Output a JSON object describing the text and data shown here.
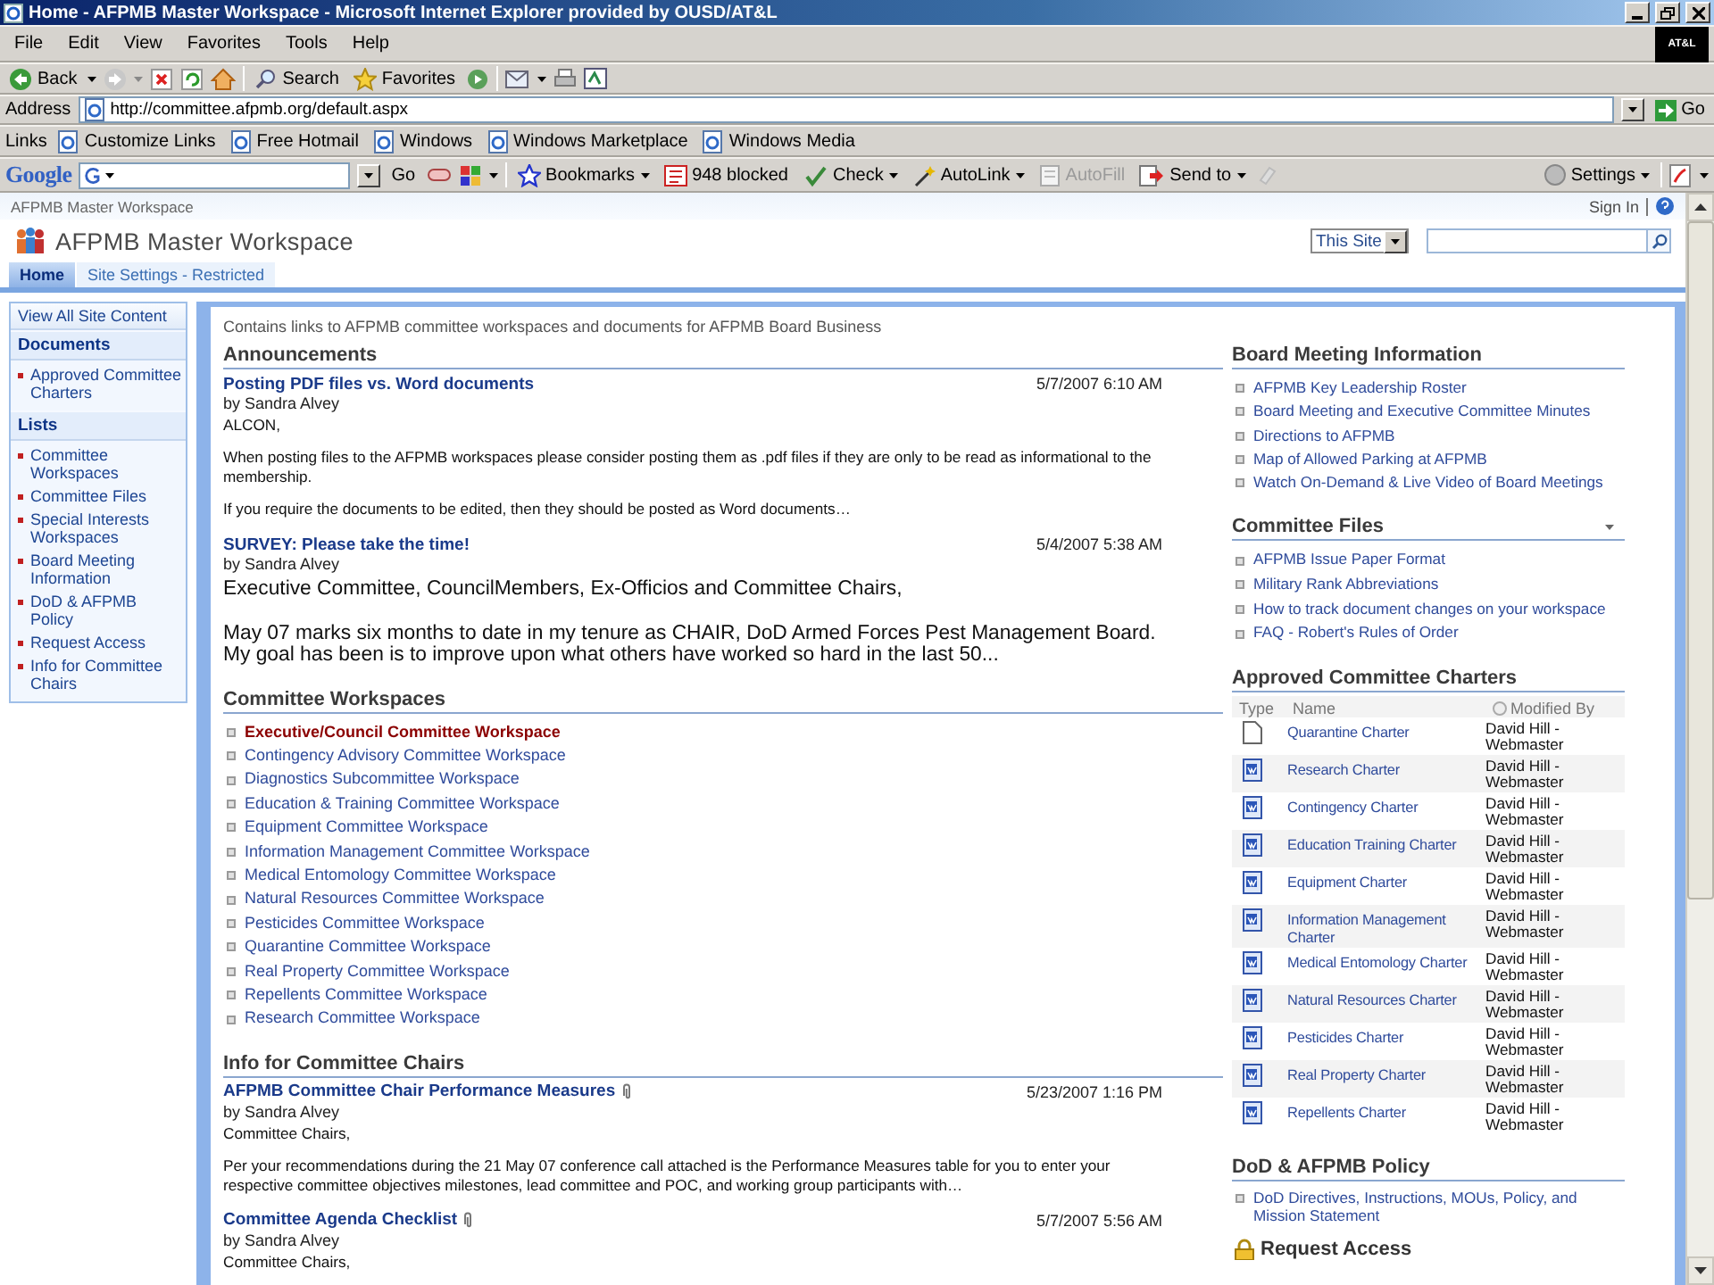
{
  "window": {
    "title": "Home - AFPMB Master Workspace - Microsoft Internet Explorer provided by OUSD/AT&L"
  },
  "menu_bar": {
    "items": [
      "File",
      "Edit",
      "View",
      "Favorites",
      "Tools",
      "Help"
    ],
    "logo": "AT&L"
  },
  "toolbar": {
    "back": "Back",
    "search": "Search",
    "favorites": "Favorites"
  },
  "address_bar": {
    "label": "Address",
    "value": "http://committee.afpmb.org/default.aspx",
    "go": "Go"
  },
  "links_bar": {
    "label": "Links",
    "items": [
      "Customize Links",
      "Free Hotmail",
      "Windows",
      "Windows Marketplace",
      "Windows Media"
    ]
  },
  "google_toolbar": {
    "logo": "Google",
    "go": "Go",
    "settings": "Settings",
    "buttons": [
      {
        "label": "Bookmarks",
        "menu": true,
        "disabled": false
      },
      {
        "label": "948 blocked",
        "menu": false,
        "disabled": false
      },
      {
        "label": "Check",
        "menu": true,
        "disabled": false
      },
      {
        "label": "AutoLink",
        "menu": true,
        "disabled": false
      },
      {
        "label": "AutoFill",
        "menu": false,
        "disabled": true
      },
      {
        "label": "Send to",
        "menu": true,
        "disabled": false
      }
    ]
  },
  "site": {
    "breadcrumb": "AFPMB Master Workspace",
    "sign_in": "Sign In",
    "title": "AFPMB Master Workspace",
    "search_scope": "This Site",
    "tabs": [
      {
        "label": "Home",
        "selected": true
      },
      {
        "label": "Site Settings - Restricted",
        "selected": false
      }
    ]
  },
  "quick_launch": {
    "view_all": "View All Site Content",
    "sections": [
      {
        "heading": "Documents",
        "items": [
          "Approved Committee Charters"
        ]
      },
      {
        "heading": "Lists",
        "items": [
          "Committee Workspaces",
          "Committee Files",
          "Special Interests Workspaces",
          "Board Meeting Information",
          "DoD & AFPMB Policy",
          "Request Access",
          "Info for Committee Chairs"
        ]
      }
    ]
  },
  "description": "Contains links to AFPMB committee workspaces and documents for AFPMB Board Business",
  "announcements": {
    "title": "Announcements",
    "items": [
      {
        "title": "Posting PDF files vs. Word documents",
        "attachment": false,
        "date": "5/7/2007 6:10 AM",
        "author": "by Sandra Alvey",
        "body": [
          {
            "kind": "small",
            "text": "ALCON,"
          },
          {
            "kind": "small",
            "text": "When posting files to the AFPMB workspaces please consider posting them as .pdf files if they are only to be read as informational to the membership."
          },
          {
            "kind": "small",
            "text": "If you require the documents to be edited, then they should be posted as Word documents…"
          }
        ]
      },
      {
        "title": "SURVEY: Please take the time!",
        "attachment": false,
        "date": "5/4/2007 5:38 AM",
        "author": "by Sandra Alvey",
        "body": [
          {
            "kind": "large",
            "text": "Executive Committee, CouncilMembers, Ex-Officios and Committee Chairs,"
          },
          {
            "kind": "large",
            "text": "May 07 marks six months to date in my tenure as CHAIR, DoD Armed Forces Pest Management Board. My goal has been is to improve upon what others have worked so hard in the last 50..."
          }
        ]
      }
    ]
  },
  "committee_workspaces": {
    "title": "Committee Workspaces",
    "items": [
      {
        "label": "Executive/Council Committee Workspace",
        "visited": true
      },
      {
        "label": "Contingency Advisory Committee Workspace",
        "visited": false
      },
      {
        "label": "Diagnostics Subcommittee Workspace",
        "visited": false
      },
      {
        "label": "Education & Training Committee Workspace",
        "visited": false
      },
      {
        "label": "Equipment Committee Workspace",
        "visited": false
      },
      {
        "label": "Information Management Committee Workspace",
        "visited": false
      },
      {
        "label": "Medical Entomology Committee Workspace",
        "visited": false
      },
      {
        "label": "Natural Resources Committee Workspace",
        "visited": false
      },
      {
        "label": "Pesticides Committee Workspace",
        "visited": false
      },
      {
        "label": "Quarantine Committee Workspace",
        "visited": false
      },
      {
        "label": "Real Property Committee Workspace",
        "visited": false
      },
      {
        "label": "Repellents Committee Workspace",
        "visited": false
      },
      {
        "label": "Research Committee Workspace",
        "visited": false
      }
    ]
  },
  "info_for_chairs": {
    "title": "Info for Committee Chairs",
    "items": [
      {
        "title": "AFPMB Committee Chair Performance Measures",
        "attachment": true,
        "date": "5/23/2007 1:16 PM",
        "author": "by Sandra Alvey",
        "body": [
          {
            "kind": "small",
            "text": "Committee Chairs,"
          },
          {
            "kind": "small",
            "text": "Per your recommendations during the 21 May 07 conference call attached is the Performance Measures table for you to enter your respective committee objectives milestones, lead committee and POC, and working group participants with…"
          }
        ]
      },
      {
        "title": "Committee Agenda Checklist",
        "attachment": true,
        "date": "5/7/2007 5:56 AM",
        "author": "by Sandra Alvey",
        "body": [
          {
            "kind": "small",
            "text": "Committee Chairs,"
          }
        ]
      }
    ]
  },
  "board_meeting_information": {
    "title": "Board Meeting Information",
    "items": [
      "AFPMB Key Leadership Roster",
      "Board Meeting and Executive Committee Minutes",
      "Directions to AFPMB",
      "Map of Allowed Parking at AFPMB",
      "Watch On-Demand & Live Video of Board Meetings"
    ]
  },
  "committee_files": {
    "title": "Committee Files",
    "items": [
      "AFPMB Issue Paper Format",
      "Military Rank Abbreviations",
      "How to track document changes on your workspace",
      "FAQ - Robert's Rules of Order"
    ]
  },
  "approved_charters": {
    "title": "Approved Committee Charters",
    "columns": [
      "Type",
      "Name",
      "Modified By"
    ],
    "rows": [
      {
        "kind": "blank",
        "name": "Quarantine Charter",
        "modified_by": "David Hill - Webmaster"
      },
      {
        "kind": "word",
        "name": "Research Charter",
        "modified_by": "David Hill - Webmaster"
      },
      {
        "kind": "word",
        "name": "Contingency Charter",
        "modified_by": "David Hill - Webmaster"
      },
      {
        "kind": "word",
        "name": "Education Training Charter",
        "modified_by": "David Hill - Webmaster"
      },
      {
        "kind": "word",
        "name": "Equipment Charter",
        "modified_by": "David Hill - Webmaster"
      },
      {
        "kind": "word",
        "name": "Information Management Charter",
        "modified_by": "David Hill - Webmaster"
      },
      {
        "kind": "word",
        "name": "Medical Entomology Charter",
        "modified_by": "David Hill - Webmaster"
      },
      {
        "kind": "word",
        "name": "Natural Resources Charter",
        "modified_by": "David Hill - Webmaster"
      },
      {
        "kind": "word",
        "name": "Pesticides Charter",
        "modified_by": "David Hill - Webmaster"
      },
      {
        "kind": "word",
        "name": "Real Property Charter",
        "modified_by": "David Hill - Webmaster"
      },
      {
        "kind": "word",
        "name": "Repellents Charter",
        "modified_by": "David Hill - Webmaster"
      }
    ]
  },
  "policy": {
    "title": "DoD & AFPMB Policy",
    "items": [
      "DoD Directives, Instructions, MOUs, Policy, and Mission Statement"
    ]
  },
  "request_access": {
    "title": "Request Access"
  }
}
